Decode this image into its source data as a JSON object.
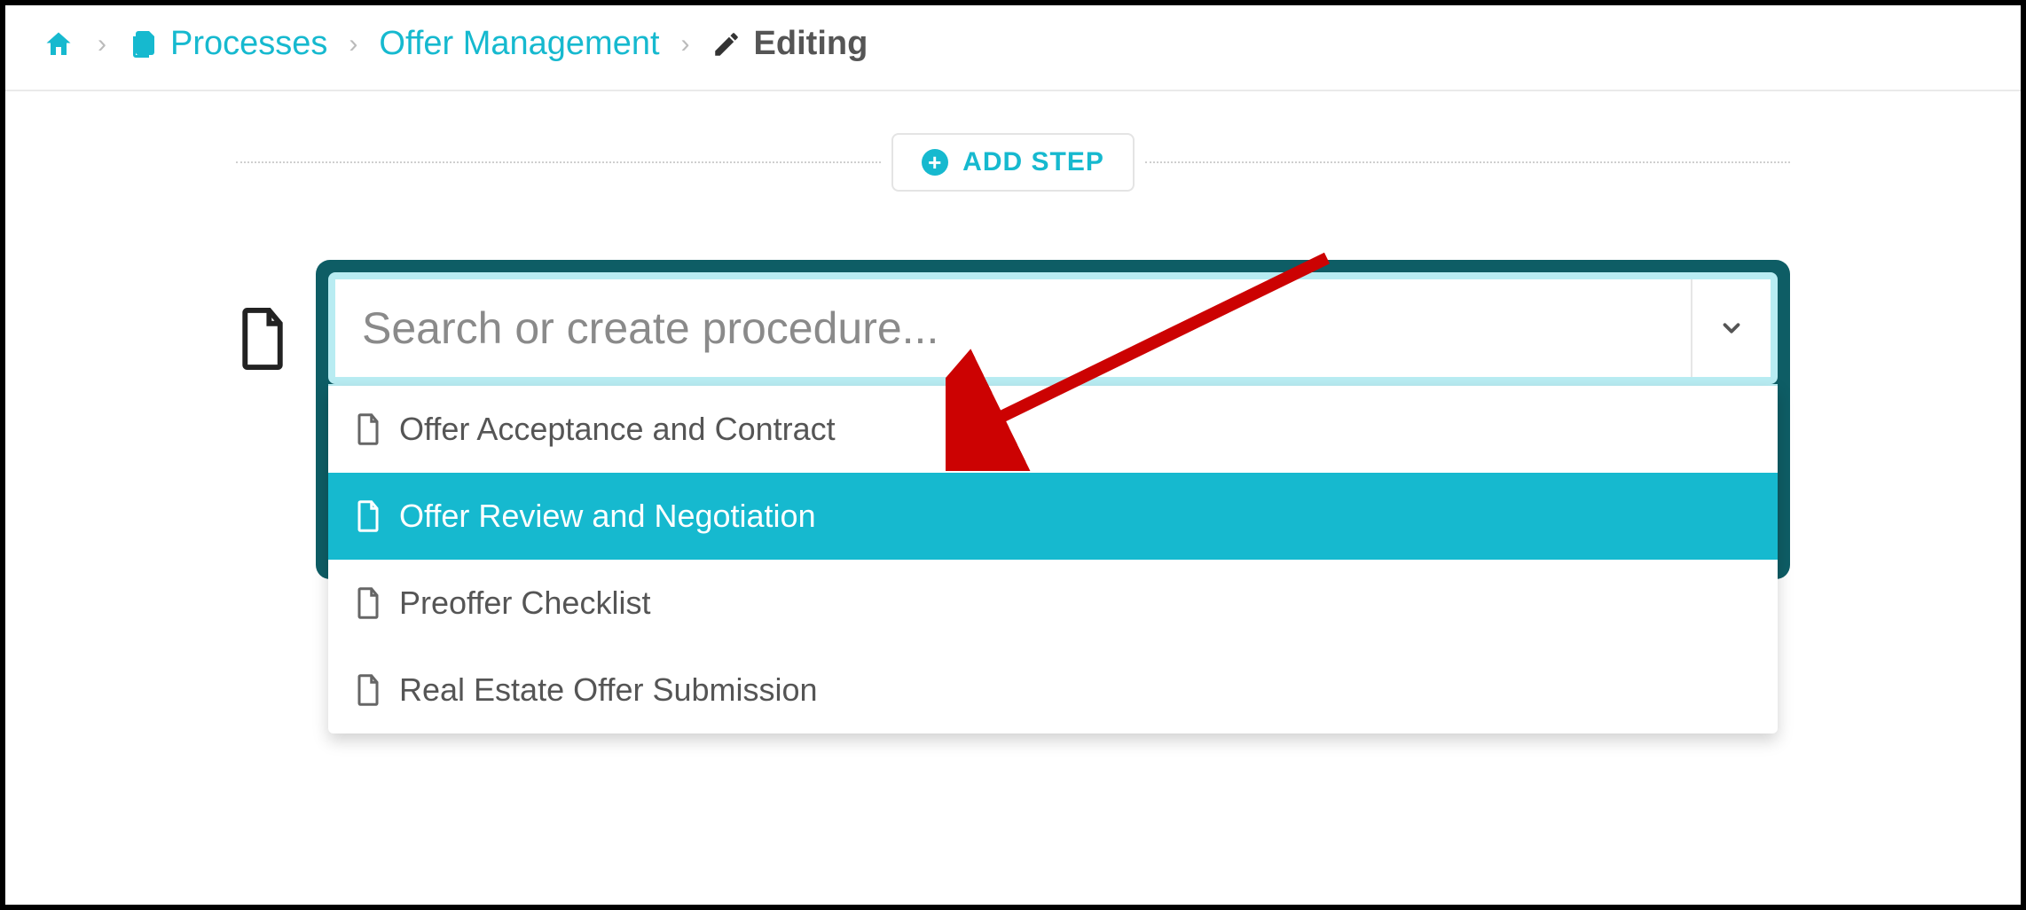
{
  "breadcrumb": {
    "processes_label": "Processes",
    "offer_mgmt_label": "Offer Management",
    "editing_label": "Editing"
  },
  "toolbar": {
    "add_step_label": "ADD STEP"
  },
  "search": {
    "placeholder": "Search or create procedure..."
  },
  "dropdown": {
    "items": [
      {
        "label": "Offer Acceptance and Contract",
        "selected": false
      },
      {
        "label": "Offer Review and Negotiation",
        "selected": true
      },
      {
        "label": "Preoffer Checklist",
        "selected": false
      },
      {
        "label": "Real Estate Offer Submission",
        "selected": false
      }
    ]
  },
  "colors": {
    "accent": "#16b9cf",
    "card_dark": "#0e5d65",
    "highlight_border": "#b8ecf2",
    "annotation": "#cc0202"
  }
}
